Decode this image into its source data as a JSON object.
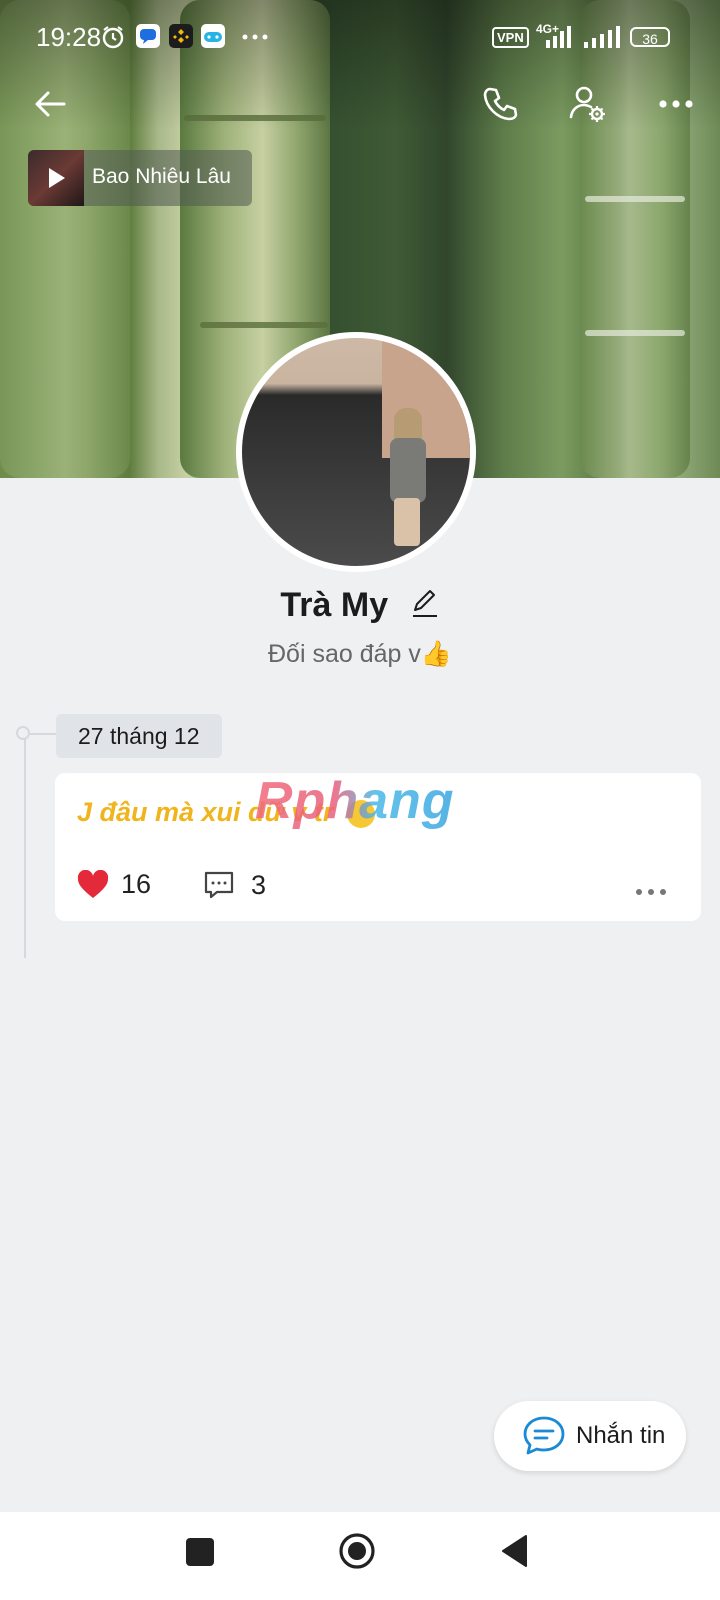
{
  "status_bar": {
    "time": "19:28",
    "vpn_label": "VPN",
    "network": "4G+",
    "battery": "36"
  },
  "music": {
    "title": "Bao Nhiêu Lâu"
  },
  "profile": {
    "name": "Trà My",
    "bio": "Đối sao đáp v👍"
  },
  "timeline": {
    "date": "27 tháng 12",
    "post": {
      "text": "J đâu mà xui dữ v tr",
      "watermark": "Rphang",
      "likes": "16",
      "comments": "3"
    }
  },
  "fab": {
    "label": "Nhắn tin"
  },
  "colors": {
    "accent": "#1a8ad4",
    "post_text": "#f0b41c",
    "heart": "#e3293a"
  },
  "icons": [
    "back-arrow-icon",
    "phone-icon",
    "profile-settings-icon",
    "more-icon",
    "play-icon",
    "edit-icon",
    "heart-icon",
    "comment-icon",
    "message-icon"
  ]
}
